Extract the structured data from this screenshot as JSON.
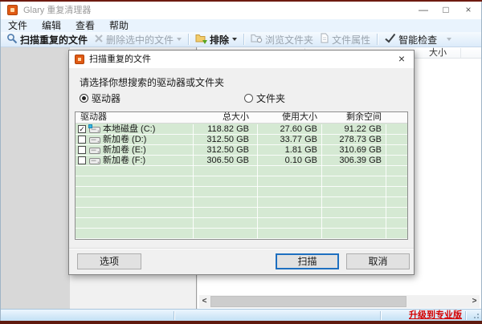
{
  "window": {
    "title": "Glary 重复清理器",
    "minimize_glyph": "—",
    "maximize_glyph": "□",
    "close_glyph": "×"
  },
  "menu": {
    "items": [
      "文件",
      "编辑",
      "查看",
      "帮助"
    ]
  },
  "toolbar": {
    "items": [
      {
        "name": "scan-duplicate-files-button",
        "icon": "magnifier",
        "label": "扫描重复的文件",
        "enabled": true,
        "bold": true
      },
      {
        "name": "delete-selected-files-button",
        "icon": "delete-x",
        "label": "删除选中的文件",
        "enabled": false,
        "dropdown": "gray"
      },
      {
        "separator": true
      },
      {
        "name": "exclude-button",
        "icon": "folder-exclude",
        "label": "排除",
        "enabled": true,
        "bold": true,
        "dropdown": "dark"
      },
      {
        "separator": true
      },
      {
        "name": "browse-folder-button",
        "icon": "browse-folder",
        "label": "浏览文件夹",
        "enabled": false
      },
      {
        "name": "file-properties-button",
        "icon": "file-properties",
        "label": "文件属性",
        "enabled": false
      },
      {
        "separator": true
      },
      {
        "name": "smart-check-button",
        "icon": "check",
        "label": "智能检查",
        "enabled": true
      },
      {
        "name": "smart-check-dropdown",
        "dropdown_only": "gray"
      }
    ]
  },
  "main": {
    "list_header": {
      "size_column": "大小"
    },
    "scrollbar": {
      "left_glyph": "<",
      "right_glyph": ">"
    },
    "statusbar": {
      "upgrade_link": "升级到专业版"
    }
  },
  "dialog": {
    "title": "扫描重复的文件",
    "close_glyph": "×",
    "prompt": "请选择你想搜索的驱动器或文件夹",
    "radio_drives": "驱动器",
    "radio_folders": "文件夹",
    "radio_selected": "驱动器",
    "table": {
      "columns": [
        "驱动器",
        "总大小",
        "使用大小",
        "剩余空间"
      ],
      "check_glyph": "✓",
      "rows": [
        {
          "checked": true,
          "system": true,
          "name": "本地磁盘 (C:)",
          "total": "118.82 GB",
          "used": "27.60 GB",
          "free": "91.22 GB"
        },
        {
          "checked": false,
          "system": false,
          "name": "新加卷 (D:)",
          "total": "312.50 GB",
          "used": "33.77 GB",
          "free": "278.73 GB"
        },
        {
          "checked": false,
          "system": false,
          "name": "新加卷 (E:)",
          "total": "312.50 GB",
          "used": "1.81 GB",
          "free": "310.69 GB"
        },
        {
          "checked": false,
          "system": false,
          "name": "新加卷 (F:)",
          "total": "306.50 GB",
          "used": "0.10 GB",
          "free": "306.39 GB"
        }
      ]
    },
    "buttons": {
      "options": "选项",
      "scan": "扫描",
      "cancel": "取消"
    }
  },
  "colors": {
    "accent_blue": "#1d6fc0",
    "row_green": "#d5e9d3",
    "link_red": "#d40000",
    "desktop_red": "#6e1b10"
  }
}
